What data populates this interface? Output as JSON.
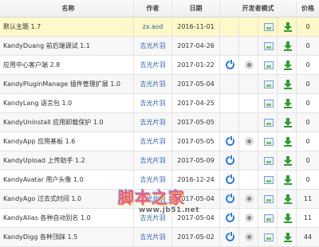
{
  "headers": {
    "name": "名称",
    "author": "作者",
    "date": "日期",
    "developer_mode": "开发者模式",
    "price": "价格"
  },
  "rows": [
    {
      "name": "默认主题 1.7",
      "author": "zx.asd",
      "date": "2016-11-01",
      "price": "0",
      "icons": [
        "",
        "",
        "image-icon",
        "download-icon"
      ],
      "selected": true
    },
    {
      "name": "KandyDuang 前后端调试 1.1",
      "author": "吉光片羽",
      "date": "2017-04-26",
      "price": "0",
      "icons": [
        "",
        "",
        "image-icon",
        "download-icon"
      ]
    },
    {
      "name": "应用中心客户端 2.8",
      "author": "吉光片羽",
      "date": "2017-01-22",
      "price": "0",
      "icons": [
        "power-icon",
        "settings-icon",
        "image-icon",
        "download-icon"
      ]
    },
    {
      "name": "KandyPluginManage 插件管理扩展 1.0",
      "author": "吉光片羽",
      "date": "2017-05-04",
      "price": "0",
      "icons": [
        "",
        "",
        "image-icon",
        "download-icon"
      ]
    },
    {
      "name": "KandyLang 语言包 1.0",
      "author": "吉光片羽",
      "date": "2017-04-25",
      "price": "0",
      "icons": [
        "",
        "",
        "image-icon",
        "download-icon"
      ]
    },
    {
      "name": "KandyUninstall 应用卸载保护 1.0",
      "author": "吉光片羽",
      "date": "2017-05-05",
      "price": "0",
      "icons": [
        "",
        "",
        "image-icon",
        "download-icon"
      ]
    },
    {
      "name": "KandyApp 应用基板 1.6",
      "author": "吉光片羽",
      "date": "2017-05-05",
      "price": "0",
      "icons": [
        "power-icon",
        "settings-icon",
        "image-icon",
        "download-icon"
      ]
    },
    {
      "name": "KandyUpload 上传助手 1.2",
      "author": "吉光片羽",
      "date": "2017-05-09",
      "price": "0",
      "icons": [
        "power-icon",
        "",
        "image-icon",
        "download-icon"
      ]
    },
    {
      "name": "KandyAvatar 用户头像 1.0",
      "author": "吉光片羽",
      "date": "2016-12-24",
      "price": "0",
      "icons": [
        "power-icon",
        "",
        "image-icon",
        "download-icon"
      ]
    },
    {
      "name": "KandyAgo 过去式时间 1.0",
      "author": "吉光片羽",
      "date": "2017-05-04",
      "price": "11",
      "icons": [
        "power-icon",
        "settings-icon",
        "image-icon",
        "download-icon"
      ]
    },
    {
      "name": "KandyAlias 各种自动别名 1.0",
      "author": "吉光片羽",
      "date": "2017-05-04",
      "price": "11",
      "icons": [
        "power-icon",
        "settings-icon",
        "image-icon",
        "download-icon"
      ]
    },
    {
      "name": "KandyDigg 各种顶踩 1.5",
      "author": "吉光片羽",
      "date": "2017-05-02",
      "price": "44",
      "icons": [
        "power-icon",
        "settings-icon",
        "image-icon",
        "download-icon"
      ]
    }
  ],
  "watermark": {
    "title": "脚本之家",
    "url": "www.jb51.net"
  },
  "colors": {
    "selected_row": "#fff8c8",
    "author_link": "#2a5ea8",
    "power": "#2a7ae2",
    "download": "#2f9e2f"
  }
}
